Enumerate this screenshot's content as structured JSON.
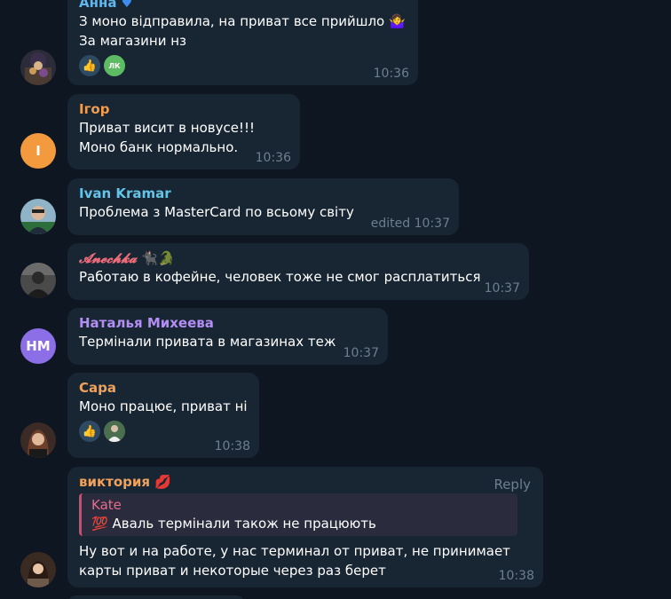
{
  "messages": [
    {
      "sender": "Анна",
      "sender_badge_icon": "blue-heart-icon",
      "lines": [
        "З моно відправила, на приват все прийшло 🤷‍♀️",
        "За магазини нз"
      ],
      "reactions": [
        {
          "icon": "thumbs-up-icon",
          "emoji": "👍"
        },
        {
          "icon": "reactor-avatar-icon",
          "label": "ЛК"
        }
      ],
      "time": "10:36",
      "colors": {
        "sender": "#5fb8ee"
      }
    },
    {
      "sender": "Ігор",
      "avatar_initials": "І",
      "lines": [
        "Приват висит в новусе!!!",
        "Моно банк нормально."
      ],
      "time": "10:36",
      "colors": {
        "sender": "#f29d4e",
        "avatar": "#f29a3d"
      }
    },
    {
      "sender": "Ivan Kramar",
      "lines": [
        "Проблема з MasterCard по всьому світу"
      ],
      "edited": "edited",
      "time": "10:37",
      "colors": {
        "sender": "#64c4e8"
      }
    },
    {
      "sender": "𝓐𝓷𝓮𝓬𝓱𝓴𝓪",
      "sender_emojis": "🐈‍⬛🐊",
      "lines": [
        "Работаю в кофейне, человек тоже не смог расплатиться"
      ],
      "time": "10:37",
      "colors": {
        "sender": "#ef6c7a"
      }
    },
    {
      "sender": "Наталья Михеева",
      "avatar_initials": "НМ",
      "lines": [
        "Термінали привата в магазинах теж"
      ],
      "time": "10:37",
      "colors": {
        "sender": "#b28ef5",
        "avatar": "#8c6ee6"
      }
    },
    {
      "sender": "Сара",
      "lines": [
        "Моно працює, приват ні"
      ],
      "reactions": [
        {
          "icon": "thumbs-up-icon",
          "emoji": "👍"
        },
        {
          "icon": "reactor-avatar-icon"
        }
      ],
      "time": "10:38",
      "colors": {
        "sender": "#f0a25a"
      }
    },
    {
      "sender": "виктория",
      "sender_emojis": "💋",
      "reply_label": "Reply",
      "quote": {
        "name": "Kate",
        "emoji": "💯",
        "text": "Аваль термінали також не працюють"
      },
      "lines": [
        "Ну вот и на работе, у нас терминал от приват, не принимает",
        "карты приват и некоторые через раз берет"
      ],
      "time": "10:38",
      "colors": {
        "sender": "#f0a25a"
      }
    }
  ]
}
